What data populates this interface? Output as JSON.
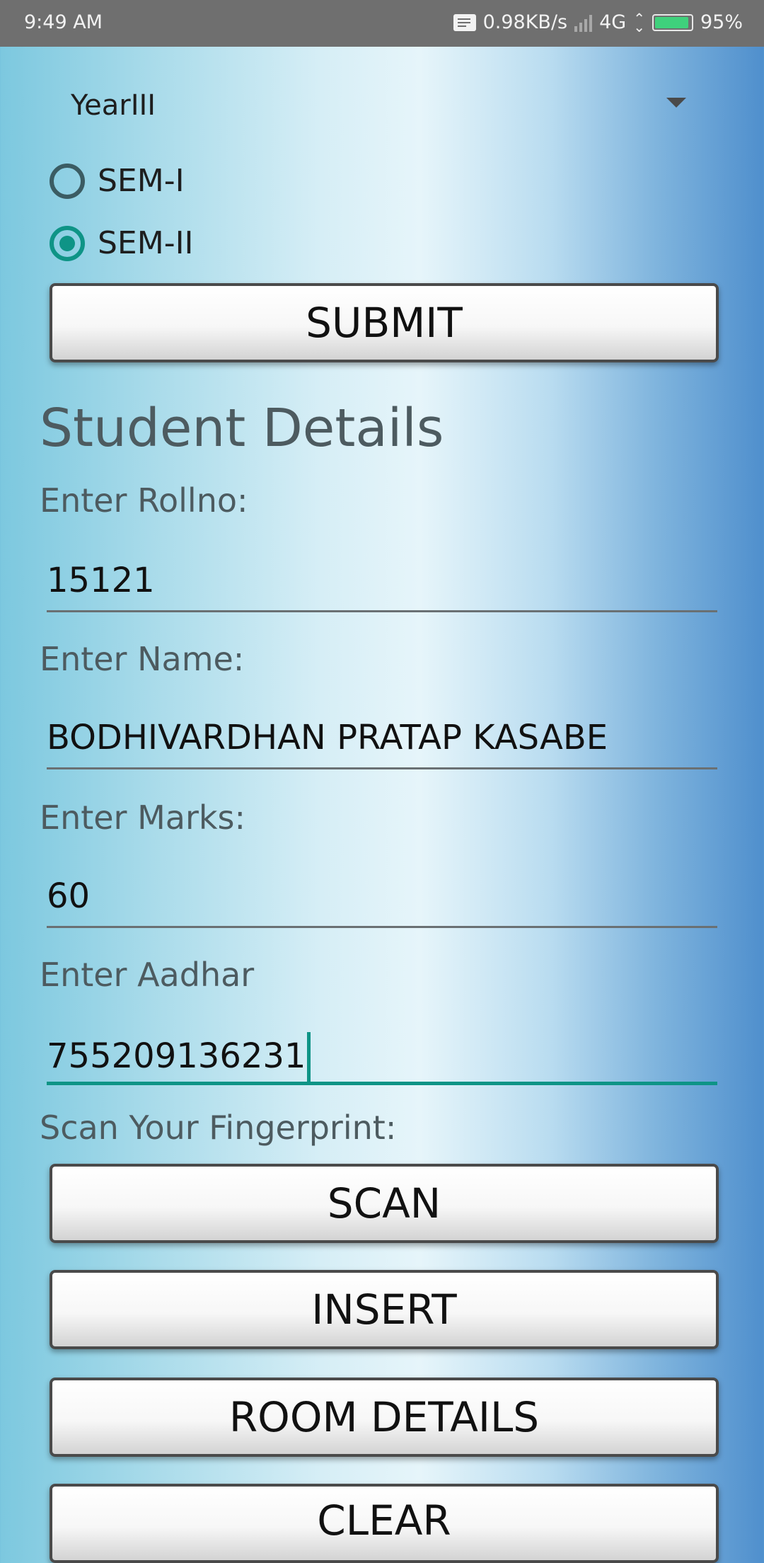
{
  "status_bar": {
    "time": "9:49 AM",
    "net_speed": "0.98KB/s",
    "network": "4G",
    "battery": "95%",
    "battery_level": 0.95
  },
  "year_select": {
    "value": "YearIII"
  },
  "semesters": [
    {
      "label": "SEM-I",
      "checked": false
    },
    {
      "label": "SEM-II",
      "checked": true
    }
  ],
  "submit_label": "SUBMIT",
  "heading": "Student Details",
  "fields": {
    "rollno": {
      "label": "Enter Rollno:",
      "value": "15121"
    },
    "name": {
      "label": "Enter Name:",
      "value": "BODHIVARDHAN PRATAP KASABE"
    },
    "marks": {
      "label": "Enter Marks:",
      "value": "60"
    },
    "aadhar": {
      "label": "Enter Aadhar",
      "value": "755209136231"
    }
  },
  "scan_label_text": "Scan Your Fingerprint:",
  "buttons": {
    "scan": "SCAN",
    "insert": "INSERT",
    "room_details": "ROOM DETAILS",
    "clear": "CLEAR"
  },
  "colors": {
    "accent": "#0e9486",
    "status_bar": "#6f6f6f"
  }
}
